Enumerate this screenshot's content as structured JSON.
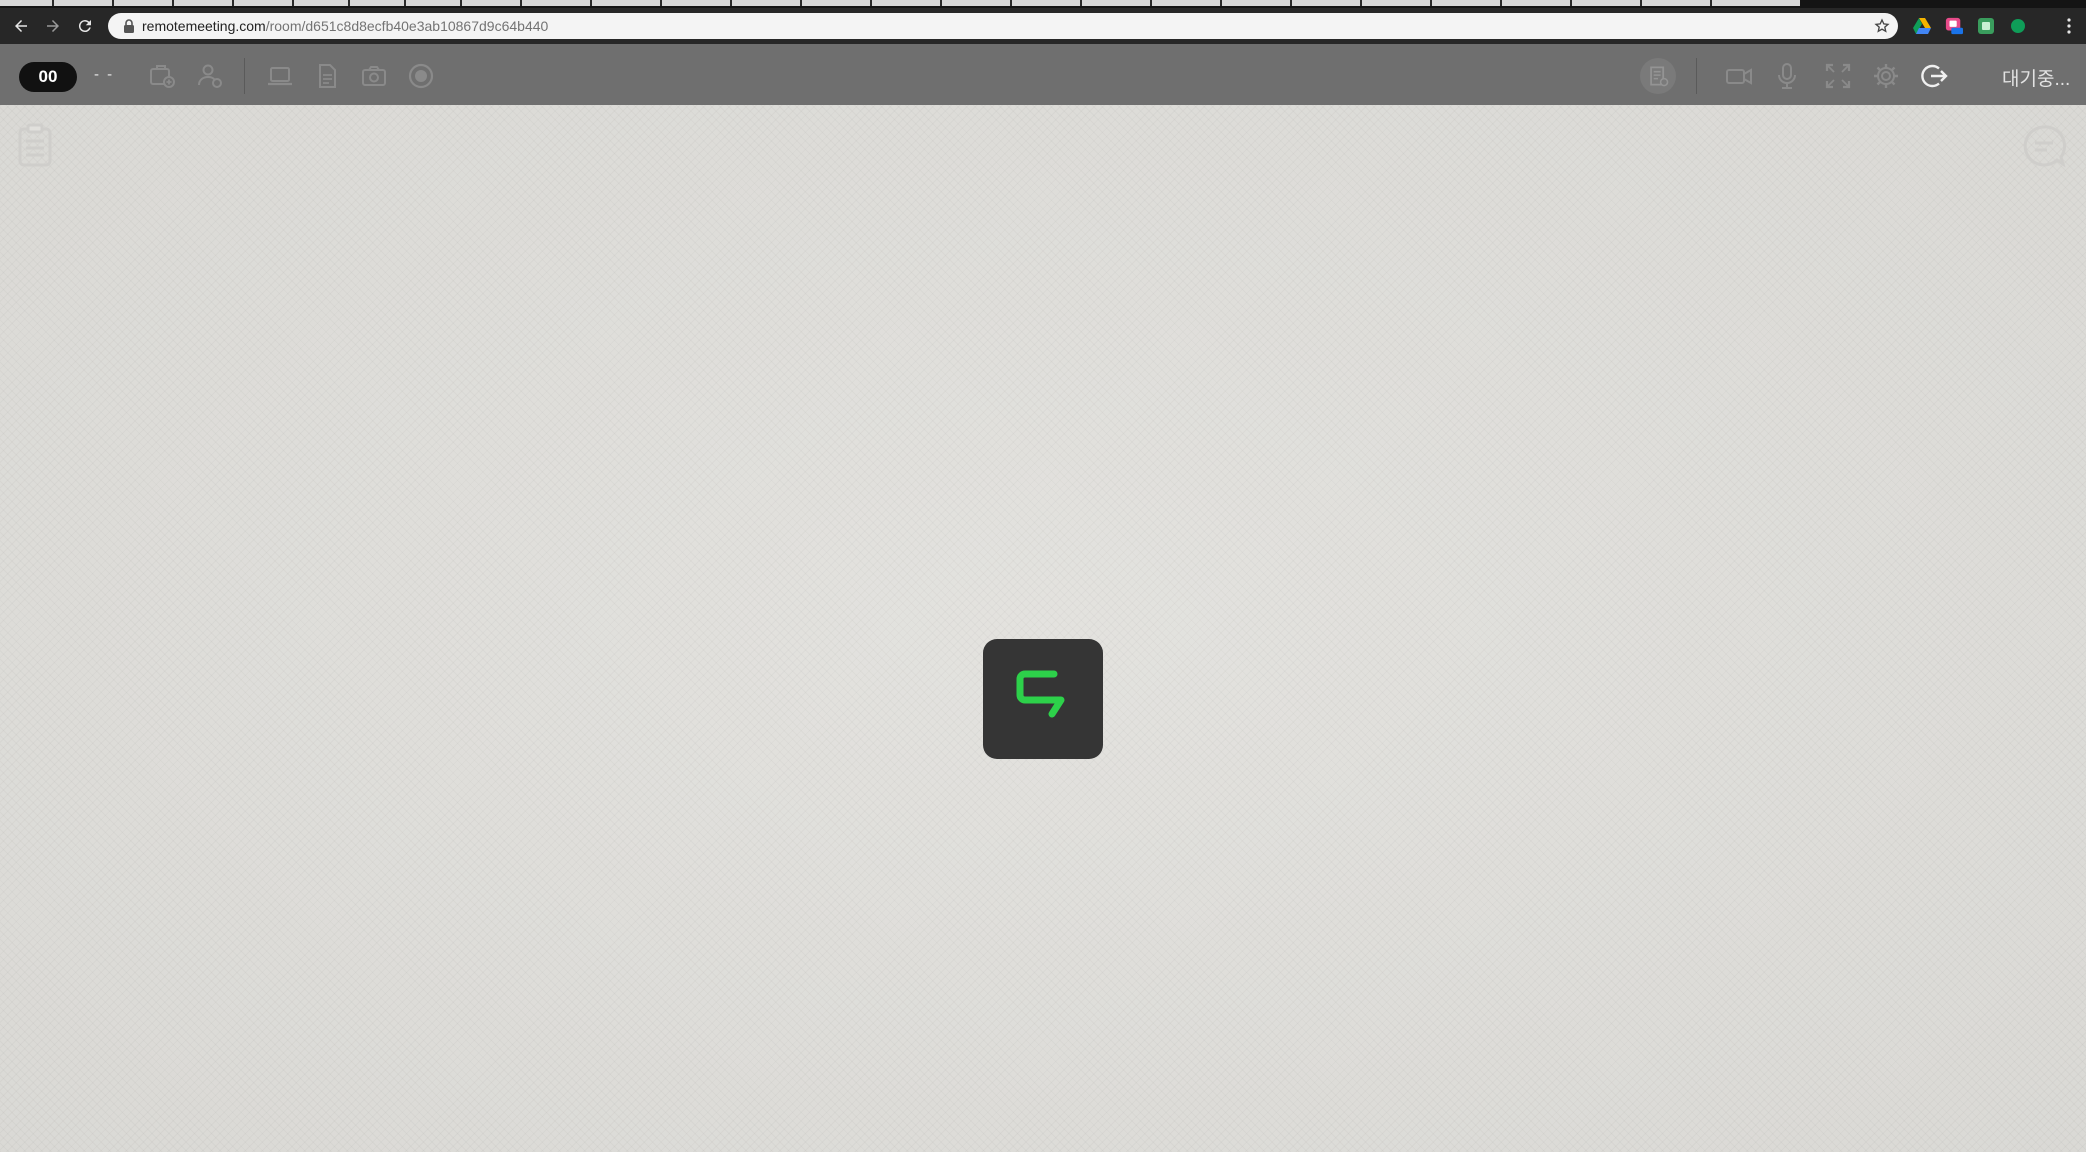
{
  "browser": {
    "url_host": "remotemeeting.com",
    "url_path": "/room/d651c8d8ecfb40e3ab10867d9c64b440",
    "icons": [
      "back-arrow-icon",
      "forward-arrow-icon",
      "reload-icon",
      "lock-icon",
      "star-icon",
      "google-drive-icon",
      "new-extension-icon",
      "green-extension-icon",
      "green-circle-extension-icon",
      "kebab-menu-icon"
    ]
  },
  "toolbar": {
    "participant_count": "00",
    "room_name_placeholder": "- -",
    "status_text": "대기중...",
    "left_icons": [
      "add-document-icon",
      "share-user-icon",
      "screen-share-icon",
      "file-icon",
      "camera-icon",
      "record-icon"
    ],
    "right_icons": [
      "meeting-minutes-icon",
      "video-camera-icon",
      "microphone-icon",
      "fullscreen-icon",
      "settings-gear-icon",
      "exit-icon"
    ]
  },
  "stage": {
    "side_icons": [
      "notes-panel-icon",
      "chat-panel-icon"
    ],
    "logo_name": "remotemeeting-logo"
  },
  "colors": {
    "toolbar_bg": "#6f6f6f",
    "stage_bg": "#e1e0dc",
    "logo_bg": "#353535",
    "logo_accent": "#2dd14a",
    "icon_muted": "#8a8a8a"
  }
}
